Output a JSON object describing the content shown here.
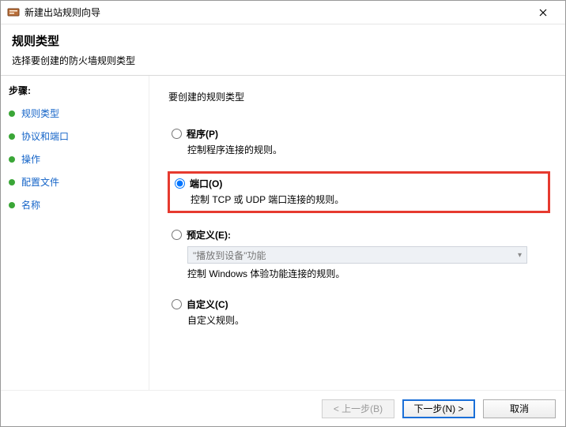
{
  "window": {
    "title": "新建出站规则向导"
  },
  "header": {
    "title": "规则类型",
    "subtitle": "选择要创建的防火墙规则类型"
  },
  "sidebar": {
    "steps_label": "步骤:",
    "items": [
      {
        "label": "规则类型"
      },
      {
        "label": "协议和端口"
      },
      {
        "label": "操作"
      },
      {
        "label": "配置文件"
      },
      {
        "label": "名称"
      }
    ]
  },
  "content": {
    "prompt": "要创建的规则类型",
    "options": {
      "program": {
        "label": "程序(P)",
        "desc": "控制程序连接的规则。"
      },
      "port": {
        "label": "端口(O)",
        "desc": "控制 TCP 或 UDP 端口连接的规则。"
      },
      "predefined": {
        "label": "预定义(E):",
        "combo_value": "\"播放到设备\"功能",
        "desc": "控制 Windows 体验功能连接的规则。"
      },
      "custom": {
        "label": "自定义(C)",
        "desc": "自定义规则。"
      }
    }
  },
  "footer": {
    "back": "< 上一步(B)",
    "next": "下一步(N) >",
    "cancel": "取消"
  }
}
